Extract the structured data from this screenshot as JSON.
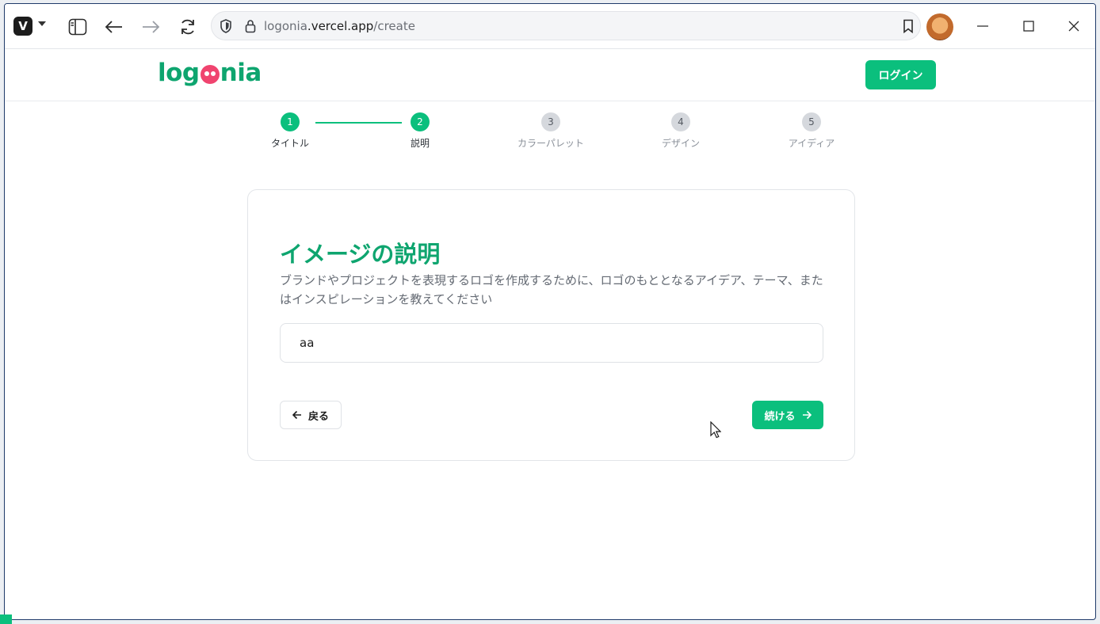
{
  "browser": {
    "url_host_prefix": "logonia",
    "url_host_main": ".vercel.app",
    "url_path": "/create",
    "app_icon": "vivaldi-logo"
  },
  "site": {
    "logo_before": "log",
    "logo_after": "nia",
    "login_label": "ログイン"
  },
  "stepper": {
    "steps": [
      {
        "number": "1",
        "label": "タイトル",
        "state": "active"
      },
      {
        "number": "2",
        "label": "説明",
        "state": "active"
      },
      {
        "number": "3",
        "label": "カラーパレット",
        "state": "inactive"
      },
      {
        "number": "4",
        "label": "デザイン",
        "state": "inactive"
      },
      {
        "number": "5",
        "label": "アイディア",
        "state": "inactive"
      }
    ]
  },
  "form": {
    "title": "イメージの説明",
    "description": "ブランドやプロジェクトを表現するロゴを作成するために、ロゴのもととなるアイデア、テーマ、またはインスピレーションを教えてください",
    "input_value": "aa",
    "back_label": "戻る",
    "next_label": "続ける"
  },
  "colors": {
    "brand_green": "#0bbf7d",
    "logo_pink": "#f0446f"
  }
}
